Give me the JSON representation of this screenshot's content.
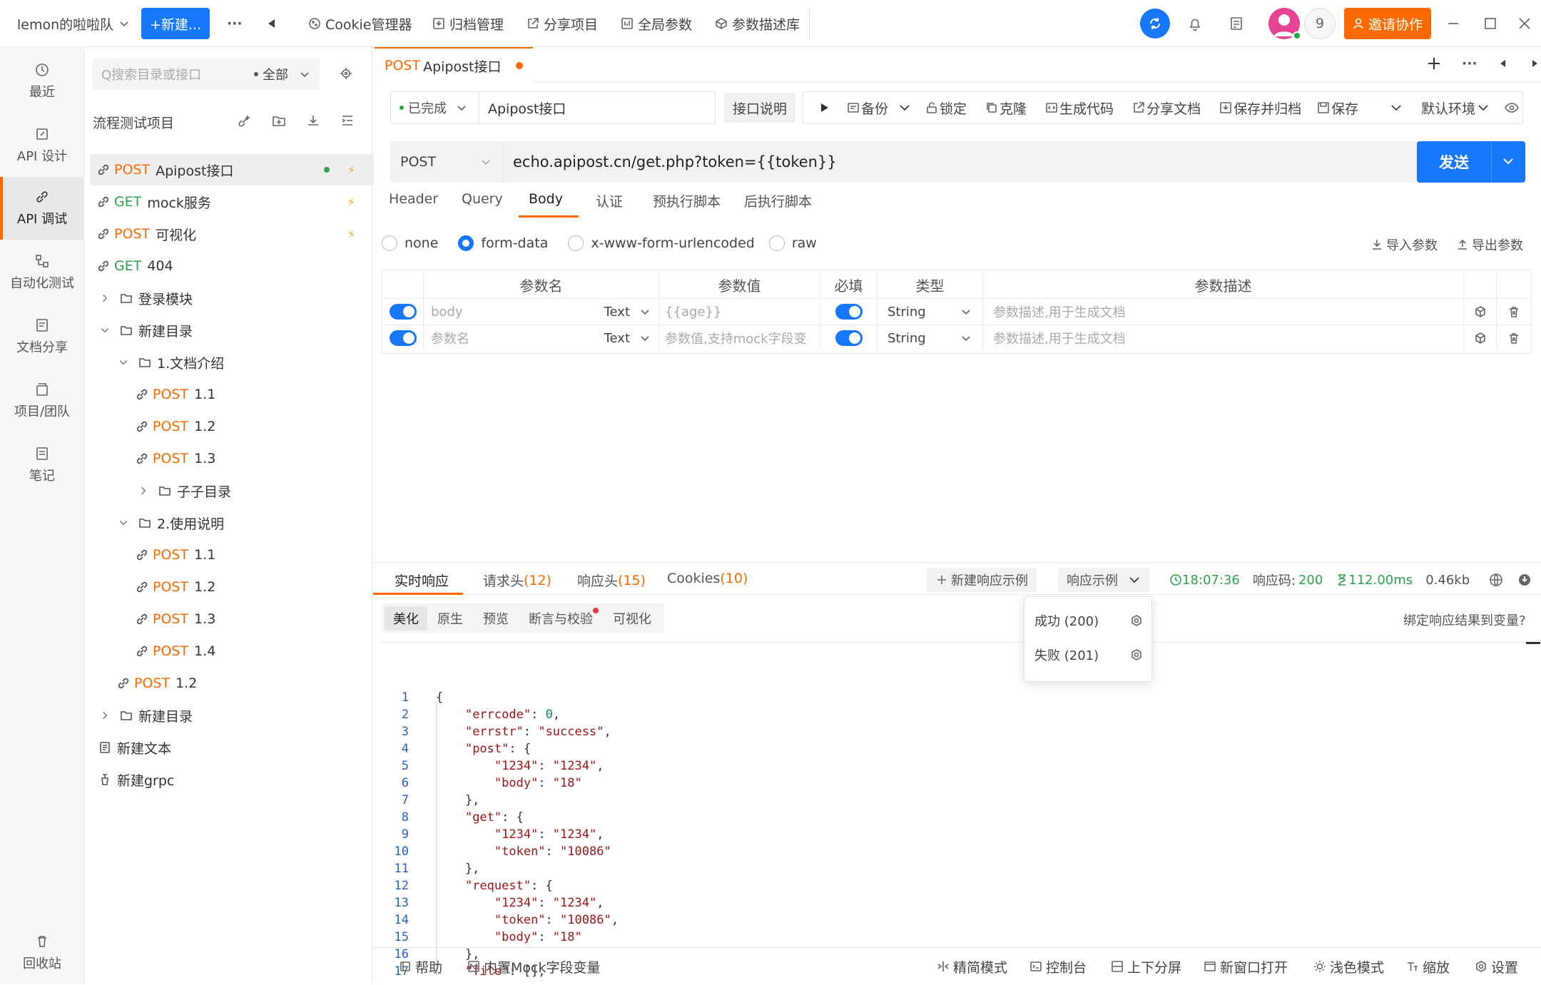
{
  "topbar": {
    "team": "lemon的啦啦队",
    "new_button": "+新建...",
    "more": "···",
    "cookie": "Cookie管理器",
    "archive": "归档管理",
    "share_project": "分享项目",
    "global_params": "全局参数",
    "param_lib": "参数描述库",
    "user_count": "9",
    "invite": "邀请协作"
  },
  "leftnav": {
    "items": [
      {
        "label": "最近"
      },
      {
        "label": "API 设计"
      },
      {
        "label": "API 调试"
      },
      {
        "label": "自动化测试"
      },
      {
        "label": "文档分享"
      },
      {
        "label": "项目/团队"
      },
      {
        "label": "笔记"
      }
    ],
    "trash": "回收站"
  },
  "tree": {
    "search_placeholder": "Q搜索目录或接口",
    "filter": "全部",
    "project": "流程测试项目",
    "rows": [
      {
        "method": "POST",
        "name": "Apipost接口"
      },
      {
        "method": "GET",
        "name": "mock服务"
      },
      {
        "method": "POST",
        "name": "可视化"
      },
      {
        "method": "GET",
        "name": "404"
      },
      {
        "name": "登录模块"
      },
      {
        "name": "新建目录"
      },
      {
        "name": "1.文档介绍"
      },
      {
        "method": "POST",
        "name": "1.1"
      },
      {
        "method": "POST",
        "name": "1.2"
      },
      {
        "method": "POST",
        "name": "1.3"
      },
      {
        "name": "子子目录"
      },
      {
        "name": "2.使用说明"
      },
      {
        "method": "POST",
        "name": "1.1"
      },
      {
        "method": "POST",
        "name": "1.2"
      },
      {
        "method": "POST",
        "name": "1.3"
      },
      {
        "method": "POST",
        "name": "1.4"
      },
      {
        "method": "POST",
        "name": "1.2"
      },
      {
        "name": "新建目录"
      },
      {
        "name": "新建文本"
      },
      {
        "name": "新建grpc"
      }
    ]
  },
  "tab": {
    "method": "POST",
    "name": "Apipost接口"
  },
  "toolbar": {
    "status": "已完成",
    "api_name": "Apipost接口",
    "desc": "接口说明",
    "backup": "备份",
    "lock": "锁定",
    "clone": "克隆",
    "gen_code": "生成代码",
    "share_doc": "分享文档",
    "save_archive": "保存并归档",
    "save": "保存",
    "env": "默认环境"
  },
  "request": {
    "method": "POST",
    "url": "echo.apipost.cn/get.php?token={{token}}",
    "send": "发送",
    "tabs": [
      "Header",
      "Query",
      "Body",
      "认证",
      "预执行脚本",
      "后执行脚本"
    ],
    "body_types": [
      "none",
      "form-data",
      "x-www-form-urlencoded",
      "raw"
    ],
    "import": "导入参数",
    "export": "导出参数",
    "columns": [
      "参数名",
      "参数值",
      "必填",
      "类型",
      "参数描述"
    ],
    "params": [
      {
        "name": "body",
        "kind": "Text",
        "value": "{{age}}",
        "type": "String",
        "desc": "参数描述,用于生成文档"
      },
      {
        "name": "参数名",
        "kind": "Text",
        "value": "参数值,支持mock字段变",
        "type": "String",
        "desc": "参数描述,用于生成文档"
      }
    ]
  },
  "response": {
    "tabs": {
      "live": "实时响应",
      "req_headers": "请求头",
      "req_headers_count": "(12)",
      "res_headers": "响应头",
      "res_headers_count": "(15)",
      "cookies": "Cookies",
      "cookies_count": "(10)"
    },
    "new_example": "新建响应示例",
    "example": "响应示例",
    "time": "18:07:36",
    "code_label": "响应码:",
    "code": "200",
    "duration": "112.00ms",
    "size": "0.46kb",
    "subtabs": [
      "美化",
      "原生",
      "预览",
      "断言与校验",
      "可视化"
    ],
    "bind": "绑定响应结果到变量?",
    "dropdown": [
      "成功 (200)",
      "失败 (201)"
    ],
    "lines": [
      "{",
      "    \"errcode\": 0,",
      "    \"errstr\": \"success\",",
      "    \"post\": {",
      "        \"1234\": \"1234\",",
      "        \"body\": \"18\"",
      "    },",
      "    \"get\": {",
      "        \"1234\": \"1234\",",
      "        \"token\": \"10086\"",
      "    },",
      "    \"request\": {",
      "        \"1234\": \"1234\",",
      "        \"token\": \"10086\",",
      "        \"body\": \"18\"",
      "    },",
      "    \"file\": [],"
    ]
  },
  "footer": {
    "help": "帮助",
    "mock": "内置Mock字段变量",
    "simple": "精简模式",
    "console": "控制台",
    "split": "上下分屏",
    "new_window": "新窗口打开",
    "theme": "浅色模式",
    "zoom": "缩放",
    "settings": "设置"
  },
  "colors": {
    "accent": "#ff6a00",
    "primary": "#1677ff",
    "success": "#2aa64a"
  }
}
